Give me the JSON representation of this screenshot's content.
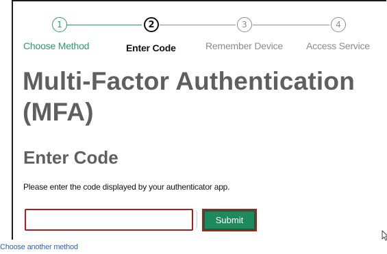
{
  "stepper": {
    "steps": [
      {
        "number": "1",
        "label": "Choose Method",
        "state": "done"
      },
      {
        "number": "2",
        "label": "Enter Code",
        "state": "active"
      },
      {
        "number": "3",
        "label": "Remember Device",
        "state": "todo"
      },
      {
        "number": "4",
        "label": "Access Service",
        "state": "todo"
      }
    ]
  },
  "main": {
    "title": "Multi-Factor Authentication (MFA)",
    "section_title": "Enter Code",
    "instructions": "Please enter the code displayed by your authenticator app.",
    "code_input_value": "",
    "submit_label": "Submit",
    "alt_method_link": "Choose another method"
  },
  "colors": {
    "accent_green": "#1e8a5c",
    "done_green": "#2a9a6a",
    "error_red": "#b01c1c",
    "link_blue": "#2b63b8",
    "heading_gray": "#5f5f5f"
  },
  "icons": {
    "cursor": "mouse-pointer-icon"
  }
}
